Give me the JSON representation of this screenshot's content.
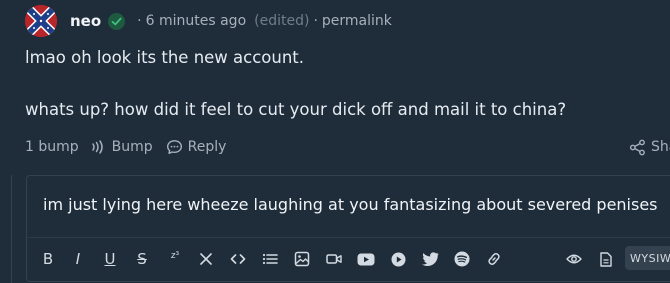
{
  "comment": {
    "username": "neo",
    "verified_icon": "check-badge-icon",
    "timestamp": "6 minutes ago",
    "edited_label": "(edited)",
    "permalink_label": "permalink",
    "body_line_1": "lmao oh look its the new account.",
    "body_line_2": "whats up?  how did it feel to cut your dick off and mail it to china?",
    "actions": {
      "bump_count": "1 bump",
      "bump_label": "Bump",
      "reply_label": "Reply",
      "share_label": "Sha"
    }
  },
  "reply_editor": {
    "text": "im just lying here wheeze laughing at you fantasizing about severed penises",
    "toolbar": {
      "bold": "B",
      "italic": "I",
      "underline": "U",
      "strike": "S",
      "superscript": "z³",
      "mode_label": "WYSIW"
    }
  },
  "colors": {
    "background": "#1f2d3b",
    "text": "#e6ebf0",
    "muted": "#a6b1bc",
    "border": "#34414e",
    "verified_bg": "#1e5a3f",
    "verified_check": "#3fbf7f"
  }
}
